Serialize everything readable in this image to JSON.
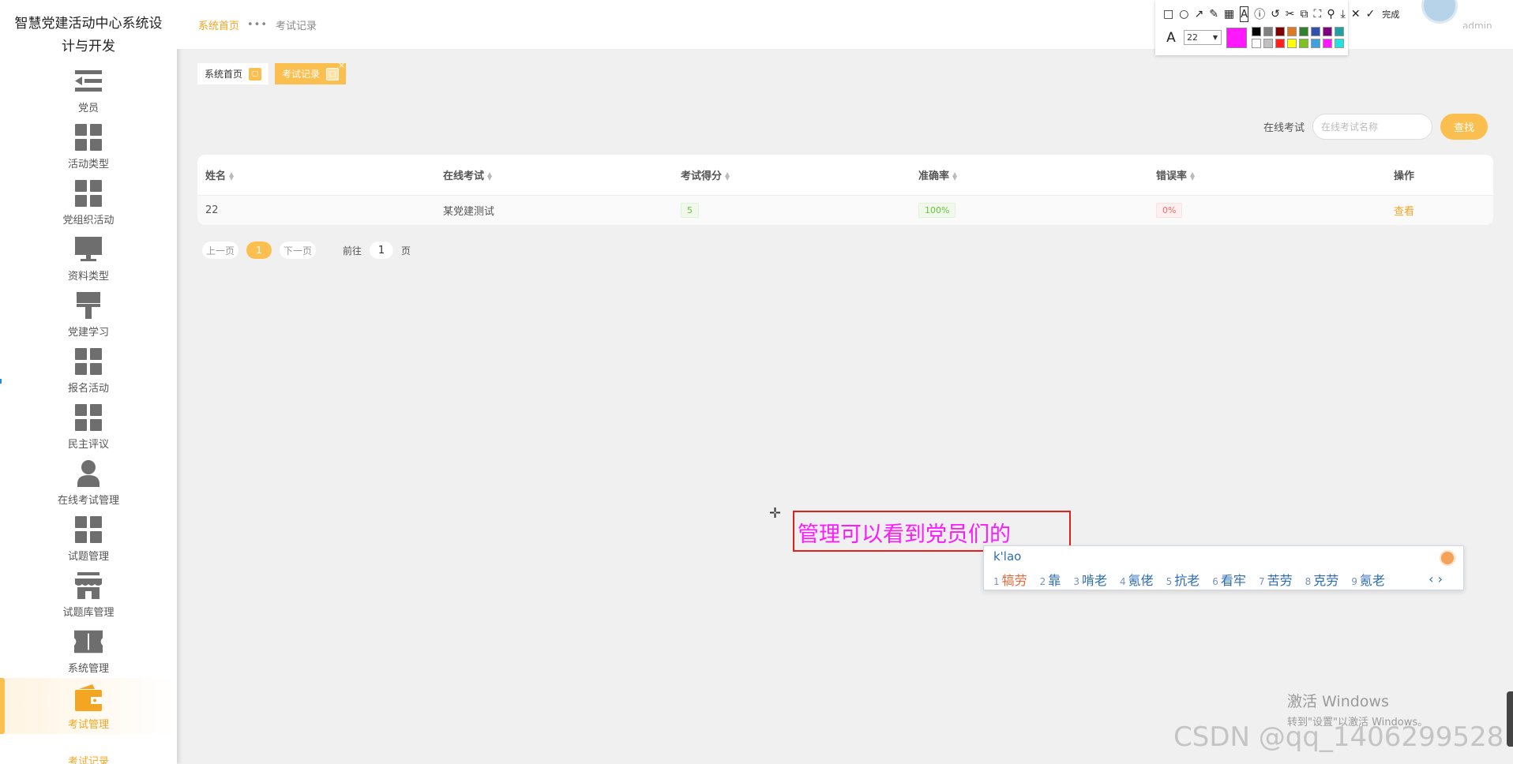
{
  "sidebar": {
    "title": "智慧党建活动中心系统设计与开发",
    "items": [
      {
        "label": "党员",
        "icon": "list-indent-icon"
      },
      {
        "label": "活动类型",
        "icon": "grid-icon"
      },
      {
        "label": "党组织活动",
        "icon": "grid-icon"
      },
      {
        "label": "资料类型",
        "icon": "monitor-icon"
      },
      {
        "label": "党建学习",
        "icon": "brush-icon"
      },
      {
        "label": "报名活动",
        "icon": "grid-icon"
      },
      {
        "label": "民主评议",
        "icon": "grid-icon"
      },
      {
        "label": "在线考试管理",
        "icon": "user-icon"
      },
      {
        "label": "试题管理",
        "icon": "grid-icon"
      },
      {
        "label": "试题库管理",
        "icon": "store-icon"
      },
      {
        "label": "系统管理",
        "icon": "ticket-icon"
      },
      {
        "label": "考试管理",
        "icon": "wallet-icon"
      }
    ],
    "active_submenu": "考试记录"
  },
  "breadcrumb": {
    "home": "系统首页",
    "separator": "•••",
    "current": "考试记录"
  },
  "tabs": [
    {
      "label": "系统首页",
      "active": false
    },
    {
      "label": "考试记录",
      "active": true,
      "close": "×"
    }
  ],
  "search": {
    "label": "在线考试",
    "placeholder": "在线考试名称",
    "button": "查找"
  },
  "table": {
    "headers": [
      "姓名",
      "在线考试",
      "考试得分",
      "准确率",
      "错误率",
      "操作"
    ],
    "rows": [
      {
        "name": "22",
        "exam": "某党建测试",
        "score": "5",
        "accuracy": "100%",
        "error_rate": "0%",
        "action": "查看"
      }
    ]
  },
  "pagination": {
    "prev": "上一页",
    "current": "1",
    "next": "下一页",
    "goto_prefix": "前往",
    "goto_value": "1",
    "goto_suffix": "页"
  },
  "snip_tool": {
    "done": "完成",
    "font_size": "22",
    "current_color": "#ff19ff",
    "palette": [
      "#000000",
      "#808080",
      "#800000",
      "#e07a20",
      "#308030",
      "#3050b0",
      "#800080",
      "#20a0a0",
      "#ffffff",
      "#c0c0c0",
      "#ff2020",
      "#ffff00",
      "#80c020",
      "#40a0e0",
      "#ff19ff",
      "#20e0e0"
    ]
  },
  "annotation": {
    "text": "管理可以看到党员们的"
  },
  "ime": {
    "composition": "k'lao",
    "candidates": [
      {
        "idx": "1",
        "text": "犒劳"
      },
      {
        "idx": "2",
        "text": "靠"
      },
      {
        "idx": "3",
        "text": "啃老"
      },
      {
        "idx": "4",
        "text": "氪佬"
      },
      {
        "idx": "5",
        "text": "抗老"
      },
      {
        "idx": "6",
        "text": "看牢"
      },
      {
        "idx": "7",
        "text": "苦劳"
      },
      {
        "idx": "8",
        "text": "克劳"
      },
      {
        "idx": "9",
        "text": "氪老"
      }
    ],
    "nav": "‹ ›"
  },
  "watermarks": {
    "windows_title": "激活 Windows",
    "windows_sub": "转到\"设置\"以激活 Windows。",
    "csdn": "CSDN @qq_1406299528"
  }
}
